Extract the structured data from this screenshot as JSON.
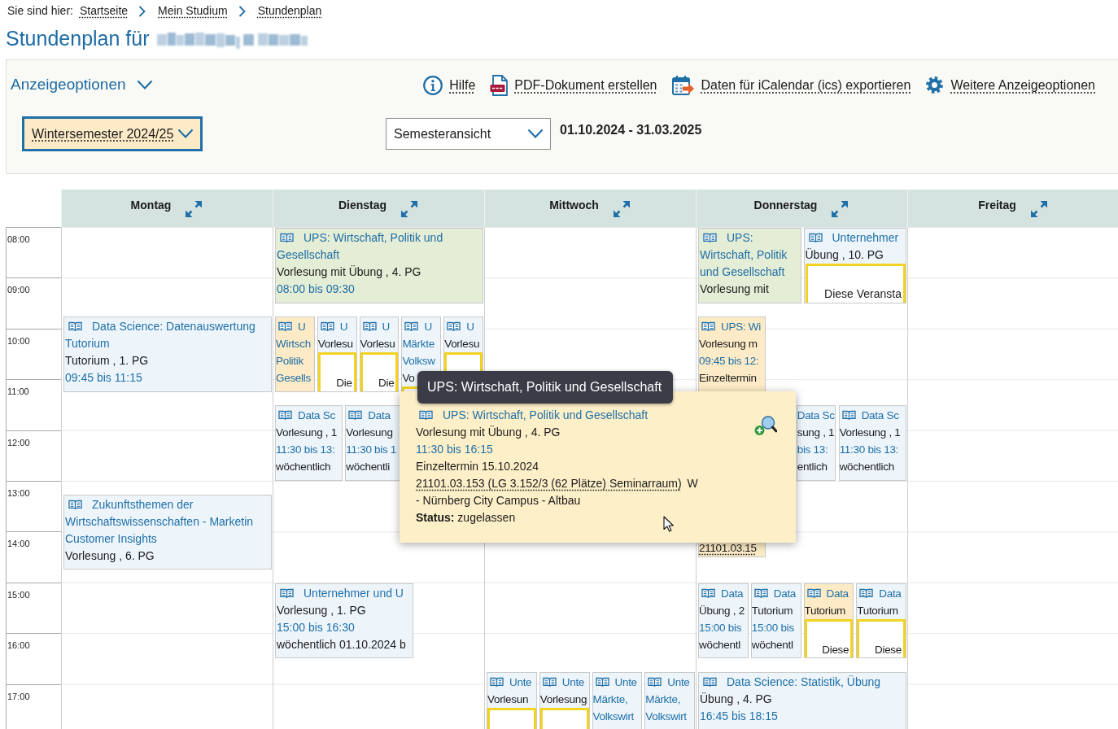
{
  "breadcrumb": {
    "label": "Sie sind hier:",
    "items": [
      "Startseite",
      "Mein Studium",
      "Stundenplan"
    ]
  },
  "title": "Stundenplan für",
  "options": {
    "toggle": "Anzeigeoptionen",
    "actions": [
      {
        "kind": "help",
        "label": "Hilfe"
      },
      {
        "kind": "pdf",
        "label": "PDF-Dokument erstellen"
      },
      {
        "kind": "ical",
        "label": "Daten für iCalendar (ics) exportieren"
      },
      {
        "kind": "settings",
        "label": "Weitere Anzeigeoptionen"
      }
    ],
    "semester_select": {
      "value": "Wintersemester 2024/25",
      "focused": true
    },
    "view_select": {
      "value": "Semesteransicht",
      "focused": false
    },
    "date_range": "01.10.2024 - 31.03.2025"
  },
  "calendar": {
    "times": [
      "08:00",
      "09:00",
      "10:00",
      "11:00",
      "12:00",
      "13:00",
      "14:00",
      "15:00",
      "16:00",
      "17:00"
    ],
    "days": [
      {
        "name": "Montag",
        "events": [
          {
            "color": "#edf5fb",
            "lines": [
              {
                "kind": "heading",
                "text": "Data Science: Datenauswertung"
              },
              {
                "kind": "title",
                "text": "Tutorium"
              },
              {
                "kind": "info",
                "text": "Tutorium , 1. PG"
              },
              {
                "kind": "time",
                "text": "09:45 bis 11:15"
              }
            ]
          },
          {
            "color": "#edf5fb",
            "lines": [
              {
                "kind": "heading",
                "text": "Zukunftsthemen der"
              },
              {
                "kind": "title",
                "text": "Wirtschaftswissenschaften - Marketin"
              },
              {
                "kind": "title",
                "text": "Customer Insights"
              },
              {
                "kind": "info",
                "text": "Vorlesung , 6. PG"
              }
            ]
          }
        ]
      },
      {
        "name": "Dienstag",
        "events": [
          {
            "color": "#e4edd5",
            "lines": [
              {
                "kind": "heading",
                "text": "UPS: Wirtschaft, Politik und"
              },
              {
                "kind": "title",
                "text": "Gesellschaft"
              },
              {
                "kind": "info",
                "text": "Vorlesung mit Übung , 4. PG"
              },
              {
                "kind": "time",
                "text": "08:00 bis 09:30"
              }
            ]
          },
          {
            "color": "#fcebc6",
            "lines": [
              {
                "kind": "heading",
                "text": "U"
              },
              {
                "kind": "title",
                "text": "Wirtsch"
              },
              {
                "kind": "title",
                "text": "Politik"
              },
              {
                "kind": "title",
                "text": "Gesells"
              }
            ]
          },
          {
            "color": "#edf5fb",
            "lines": [
              {
                "kind": "heading",
                "text": "U"
              },
              {
                "kind": "info",
                "text": "Vorlesu"
              },
              {
                "kind": "notice",
                "text": "Die"
              }
            ]
          },
          {
            "color": "#edf5fb",
            "lines": [
              {
                "kind": "heading",
                "text": "U"
              },
              {
                "kind": "info",
                "text": "Vorlesu"
              },
              {
                "kind": "notice",
                "text": "Die"
              }
            ]
          },
          {
            "color": "#edf5fb",
            "lines": [
              {
                "kind": "heading",
                "text": "U"
              },
              {
                "kind": "title",
                "text": "Märkte"
              },
              {
                "kind": "title",
                "text": "Volksw"
              },
              {
                "kind": "info",
                "text": "Vo"
              },
              {
                "kind": "notice"
              }
            ]
          },
          {
            "color": "#edf5fb",
            "lines": [
              {
                "kind": "heading",
                "text": "U"
              },
              {
                "kind": "info",
                "text": "Vorlesu"
              },
              {
                "kind": "notice"
              }
            ]
          },
          {
            "color": "#edf5fb",
            "lines": [
              {
                "kind": "heading",
                "text": "Data Sc"
              },
              {
                "kind": "info",
                "text": "Vorlesung , 1"
              },
              {
                "kind": "time",
                "text": "11:30 bis 13:"
              },
              {
                "kind": "info",
                "text": "wöchentlich"
              }
            ]
          },
          {
            "color": "#edf5fb",
            "lines": [
              {
                "kind": "heading",
                "text": "Data"
              },
              {
                "kind": "info",
                "text": "Vorlesung"
              },
              {
                "kind": "time",
                "text": "11:30 bis 1"
              },
              {
                "kind": "info",
                "text": "wöchentli"
              }
            ]
          },
          {
            "color": "#edf5fb",
            "lines": [
              {
                "kind": "heading",
                "text": "Unternehmer und U"
              },
              {
                "kind": "info",
                "text": "Vorlesung , 1. PG"
              },
              {
                "kind": "time",
                "text": "15:00 bis 16:30"
              },
              {
                "kind": "info",
                "text": "wöchentlich 01.10.2024 b"
              }
            ]
          }
        ]
      },
      {
        "name": "Mittwoch",
        "events": [
          {
            "color": "#edf5fb",
            "lines": [
              {
                "kind": "heading",
                "text": "Unte"
              },
              {
                "kind": "info",
                "text": "Vorlesun"
              },
              {
                "kind": "notice"
              }
            ]
          },
          {
            "color": "#edf5fb",
            "lines": [
              {
                "kind": "heading",
                "text": "Unte"
              },
              {
                "kind": "info",
                "text": "Vorlesung"
              },
              {
                "kind": "notice"
              }
            ]
          },
          {
            "color": "#edf5fb",
            "lines": [
              {
                "kind": "heading",
                "text": "Unte"
              },
              {
                "kind": "title",
                "text": "Märkte,"
              },
              {
                "kind": "title",
                "text": "Volkswirt"
              }
            ]
          },
          {
            "color": "#edf5fb",
            "lines": [
              {
                "kind": "heading",
                "text": "Unte"
              },
              {
                "kind": "title",
                "text": "Märkte,"
              },
              {
                "kind": "title",
                "text": "Volkswirt"
              }
            ]
          }
        ]
      },
      {
        "name": "Donnerstag",
        "events": [
          {
            "color": "#e4edd5",
            "lines": [
              {
                "kind": "heading",
                "text": "UPS:"
              },
              {
                "kind": "title",
                "text": "Wirtschaft, Politik"
              },
              {
                "kind": "title",
                "text": "und Gesellschaft"
              },
              {
                "kind": "info",
                "text": "Vorlesung mit"
              }
            ]
          },
          {
            "color": "#edf5fb",
            "lines": [
              {
                "kind": "heading",
                "text": "Unternehmer"
              },
              {
                "kind": "info",
                "text": "Übung , 10. PG"
              },
              {
                "kind": "notice",
                "text": "Diese Veransta"
              }
            ]
          },
          {
            "color": "#fcebc6",
            "lines": [
              {
                "kind": "heading",
                "text": "UPS: Wi"
              },
              {
                "kind": "info",
                "text": "Vorlesung m"
              },
              {
                "kind": "time",
                "text": "09:45 bis 12:"
              },
              {
                "kind": "info",
                "text": "Einzeltermin"
              }
            ],
            "bottom_lines": [
              {
                "kind": "room",
                "text": "21101.03.15"
              }
            ]
          },
          {
            "color": "#edf5fb",
            "lines": [
              {
                "kind": "title",
                "text": "Data Sc"
              },
              {
                "kind": "info",
                "text": "sung , 1"
              },
              {
                "kind": "time",
                "text": "bis 13:"
              },
              {
                "kind": "info",
                "text": "entlich"
              }
            ]
          },
          {
            "color": "#edf5fb",
            "lines": [
              {
                "kind": "heading",
                "text": "Data Sc"
              },
              {
                "kind": "info",
                "text": "Vorlesung , 1"
              },
              {
                "kind": "time",
                "text": "11:30 bis 13:"
              },
              {
                "kind": "info",
                "text": "wöchentlich"
              }
            ]
          },
          {
            "color": "#edf5fb",
            "lines": [
              {
                "kind": "heading",
                "text": "Data"
              },
              {
                "kind": "info",
                "text": "Übung , 2"
              },
              {
                "kind": "time",
                "text": "15:00 bis"
              },
              {
                "kind": "info",
                "text": "wöchentl"
              }
            ]
          },
          {
            "color": "#edf5fb",
            "lines": [
              {
                "kind": "heading",
                "text": "Data"
              },
              {
                "kind": "info",
                "text": "Tutorium"
              },
              {
                "kind": "time",
                "text": "15:00 bis"
              },
              {
                "kind": "info",
                "text": "wöchentl"
              }
            ]
          },
          {
            "color": "#fcebc6",
            "lines": [
              {
                "kind": "heading",
                "text": "Data"
              },
              {
                "kind": "info",
                "text": "Tutorium"
              },
              {
                "kind": "notice",
                "text": "Diese"
              }
            ]
          },
          {
            "color": "#edf5fb",
            "lines": [
              {
                "kind": "heading",
                "text": "Data"
              },
              {
                "kind": "info",
                "text": "Tutorium"
              },
              {
                "kind": "notice",
                "text": "Diese"
              }
            ]
          },
          {
            "color": "#edf5fb",
            "lines": [
              {
                "kind": "heading",
                "text": "Data Science: Statistik, Übung"
              },
              {
                "kind": "info",
                "text": "Übung , 4. PG"
              },
              {
                "kind": "time",
                "text": "16:45 bis 18:15"
              }
            ]
          }
        ]
      },
      {
        "name": "Freitag"
      }
    ]
  },
  "popover": {
    "tooltip": "UPS: Wirtschaft, Politik und Gesellschaft",
    "lines": [
      {
        "kind": "heading",
        "text": "UPS: Wirtschaft, Politik und Gesellschaft"
      },
      {
        "kind": "info",
        "text": "Vorlesung mit Übung , 4. PG"
      },
      {
        "kind": "time",
        "text": "11:30 bis 16:15"
      },
      {
        "kind": "info",
        "text": "Einzeltermin 15.10.2024"
      },
      {
        "kind": "room",
        "text": "21101.03.153 (LG 3.152/3 (62 Plätze) Seminarraum)",
        "suffix": "W"
      },
      {
        "kind": "info",
        "text": "- Nürnberg City Campus - Altbau"
      },
      {
        "kind": "info",
        "text": "**Status:** zugelassen"
      }
    ]
  }
}
